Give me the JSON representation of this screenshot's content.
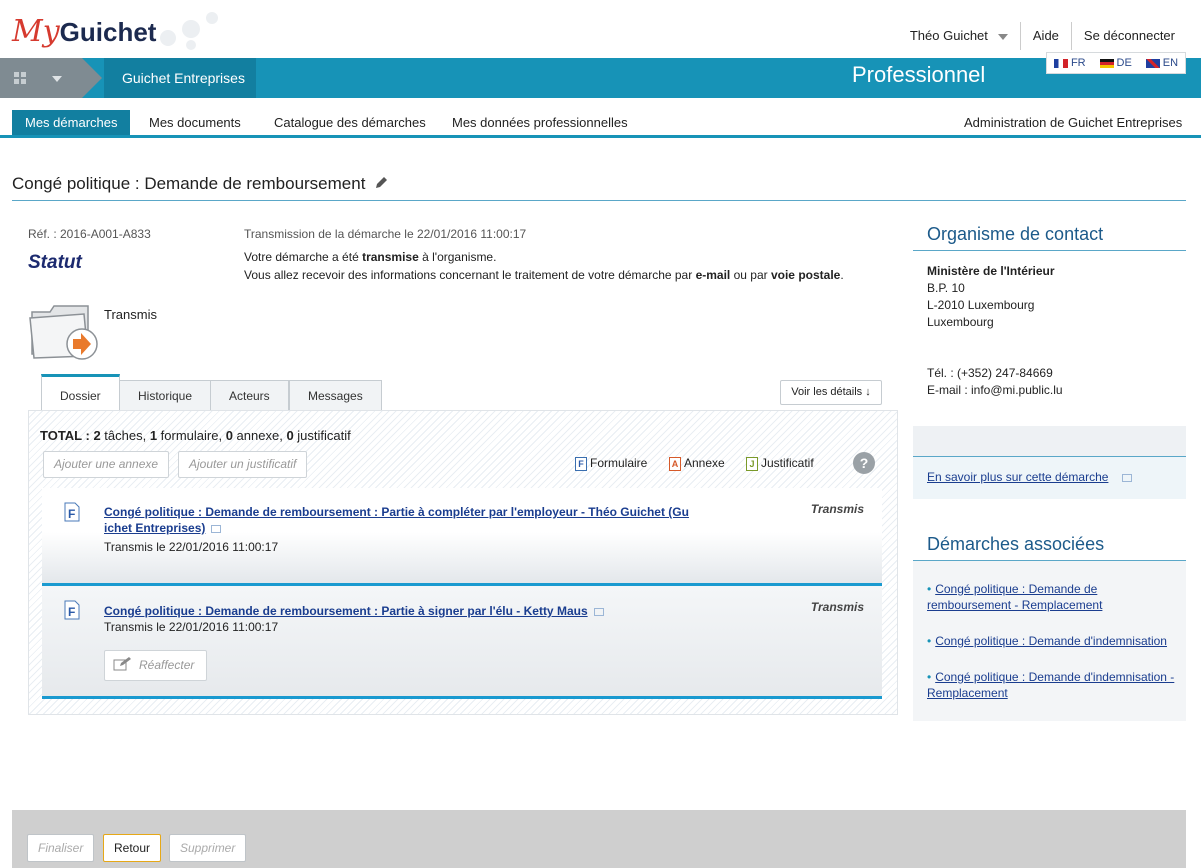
{
  "header": {
    "logo_my": "My",
    "logo_rest": "Guichet",
    "user_name": "Théo Guichet",
    "help_link": "Aide",
    "logout_link": "Se déconnecter"
  },
  "bluebar": {
    "app_title": "Guichet Entreprises",
    "space_title": "Professionnel"
  },
  "languages": [
    {
      "code": "FR"
    },
    {
      "code": "DE"
    },
    {
      "code": "EN"
    }
  ],
  "nav": {
    "tabs": [
      "Mes démarches",
      "Mes documents",
      "Catalogue des démarches",
      "Mes données professionnelles"
    ],
    "admin": "Administration de Guichet Entreprises"
  },
  "page": {
    "title": "Congé politique : Demande de remboursement",
    "ref": "Réf. : 2016-A001-A833",
    "statut_label": "Statut",
    "transmission_date": "Transmission de la démarche le 22/01/2016 11:00:17",
    "msg_line1_a": "Votre démarche a été ",
    "msg_line1_b": "transmise",
    "msg_line1_c": " à l'organisme.",
    "msg_line2_a": "Vous allez recevoir des informations concernant le traitement de votre démarche par ",
    "msg_line2_b": "e-mail",
    "msg_line2_c": " ou par ",
    "msg_line2_d": "voie postale",
    "msg_line2_e": ".",
    "status_text": "Transmis"
  },
  "tabs": {
    "items": [
      "Dossier",
      "Historique",
      "Acteurs",
      "Messages"
    ],
    "details_btn": "Voir les détails ↓"
  },
  "dossier": {
    "total_label": "TOTAL : ",
    "n_taches": "2",
    "taches_word": " tâches, ",
    "n_formulaire": "1",
    "formulaire_word": " formulaire, ",
    "n_annexe": "0",
    "annexe_word": " annexe, ",
    "n_justificatif": "0",
    "justificatif_word": " justificatif",
    "add_annexe": "Ajouter une annexe",
    "add_justificatif": "Ajouter un justificatif",
    "legend_formulaire": "Formulaire",
    "legend_annexe": "Annexe",
    "legend_justificatif": "Justificatif",
    "help": "?"
  },
  "tasks": [
    {
      "title_line1": "Congé politique : Demande de remboursement : Partie à compléter par l'employeur - Théo Guichet (Gu",
      "title_line2": "ichet Entreprises)",
      "date": "Transmis le 22/01/2016 11:00:17",
      "status": "Transmis"
    },
    {
      "title_line1": "Congé politique : Demande de remboursement : Partie à signer par l'élu - Ketty Maus",
      "date": "Transmis le 22/01/2016 11:00:17",
      "status": "Transmis",
      "action": "Réaffecter"
    }
  ],
  "sidebar": {
    "contact_heading": "Organisme de contact",
    "org_name": "Ministère de l'Intérieur",
    "addr1": "B.P. 10",
    "addr2": "L-2010 Luxembourg",
    "addr3": "Luxembourg",
    "tel": "Tél. : (+352) 247-84669",
    "email": "E-mail : info@mi.public.lu",
    "savoir_plus": "En savoir plus sur cette démarche",
    "assoc_heading": "Démarches associées",
    "assoc": [
      "Congé politique : Demande de remboursement - Remplacement",
      "Congé politique : Demande d'indemnisation",
      "Congé politique : Demande d'indemnisation - Remplacement"
    ]
  },
  "footer": {
    "finaliser": "Finaliser",
    "retour": "Retour",
    "supprimer": "Supprimer"
  },
  "colors": {
    "primary_blue": "#1793b7",
    "dark_blue": "#127fa0",
    "logo_red": "#d63a2f",
    "link": "#1a3d8f"
  }
}
